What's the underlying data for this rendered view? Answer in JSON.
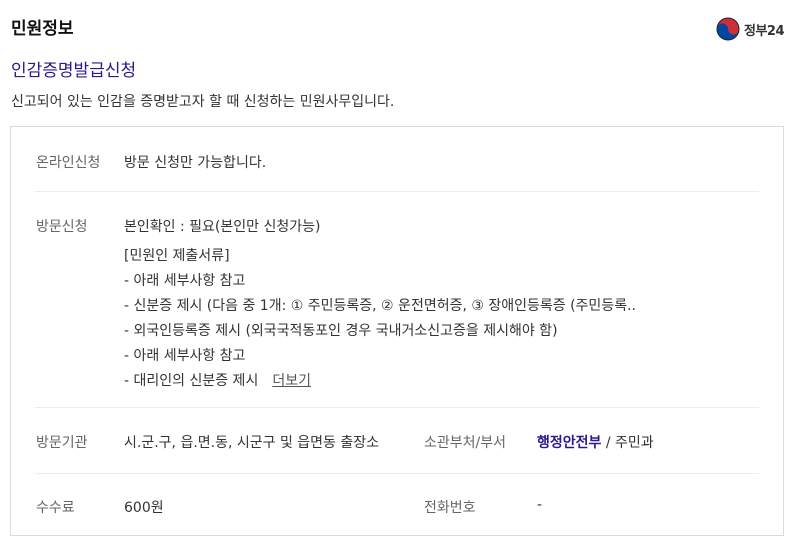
{
  "header": {
    "section_title": "민원정보",
    "logo_text": "정부24"
  },
  "service": {
    "title": "인감증명발급신청",
    "description": "신고되어 있는 인감을 증명받고자 할 때 신청하는 민원사무입니다."
  },
  "info": {
    "online": {
      "label": "온라인신청",
      "value": "방문 신청만 가능합니다."
    },
    "visit": {
      "label": "방문신청",
      "identity": "본인확인 : 필요(본인만 신청가능)",
      "docs": [
        "[민원인 제출서류]",
        "- 아래 세부사항 참고",
        "- 신분증 제시 (다음 중 1개: ① 주민등록증, ② 운전면허증, ③ 장애인등록증 (주민등록..",
        "- 외국인등록증 제시 (외국국적동포인 경우 국내거소신고증을 제시해야 함)",
        "- 아래 세부사항 참고",
        "- 대리인의 신분증 제시"
      ],
      "more_label": "더보기"
    },
    "agency": {
      "label": "방문기관",
      "value": "시.군.구, 읍.면.동, 시군구 및 읍면동 출장소",
      "dept_label": "소관부처/부서",
      "dept_link": "행정안전부",
      "dept_rest": " / 주민과"
    },
    "fee": {
      "label": "수수료",
      "value": "600원",
      "phone_label": "전화번호",
      "phone_value": "-"
    }
  },
  "colors": {
    "accent": "#2b1a8c",
    "logo_red": "#cd2e3a",
    "logo_blue": "#0047a0"
  }
}
